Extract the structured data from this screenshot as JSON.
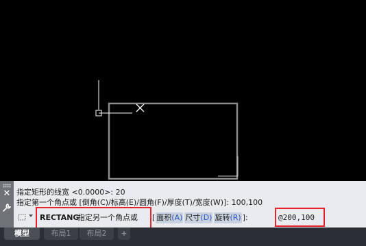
{
  "history": {
    "line1": "指定矩形的线宽 <0.0000>: 20",
    "line2": "指定第一个角点或 [倒角(C)/标高(E)/圆角(F)/厚度(T)/宽度(W)]: 100,100"
  },
  "command": {
    "name": "RECTANG",
    "prompt": "指定另一个角点或",
    "open_bracket": "[",
    "options": [
      {
        "label": "面积",
        "key": "(A)"
      },
      {
        "label": "尺寸",
        "key": "(D)"
      },
      {
        "label": "旋转",
        "key": "(R)"
      }
    ],
    "close_bracket": "]:",
    "input_value": "@200,100"
  },
  "toolstrip": {
    "close_symbol": "✕",
    "customize_symbol": "🔧"
  },
  "tabs": [
    {
      "label": "模型",
      "active": true
    },
    {
      "label": "布局1",
      "active": false
    },
    {
      "label": "布局2",
      "active": false
    },
    {
      "label": "+",
      "active": false
    }
  ],
  "colors": {
    "canvas": "#000000",
    "geometry": "#8c8c8c",
    "crosshair": "#ffffff",
    "highlight_box": "#e8232b",
    "option_key": "#2a56c6"
  },
  "icons": {
    "command_icon": "rectangle-dotted-icon",
    "close": "close-icon",
    "customize": "wrench-icon",
    "dropdown": "chevron-down-icon"
  }
}
